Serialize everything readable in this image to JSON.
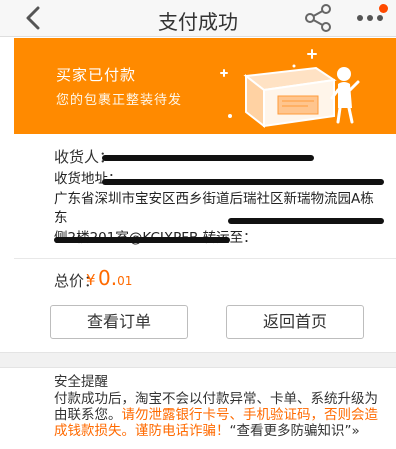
{
  "header": {
    "title": "支付成功",
    "back_icon": "back-arrow-icon",
    "share_icon": "share-icon",
    "more_icon": "more-dots-icon",
    "accent": "#ff8a00"
  },
  "banner": {
    "title": "买家已付款",
    "subtitle": "您的包裹正整装待发",
    "bg_color": "#ff8a00"
  },
  "order": {
    "recipient_label": "收货人：",
    "recipient_value": "",
    "address_label": "收货地址：",
    "address_line1": "广东省深圳市宝安区西乡街道后瑞社区新瑞物流园A栋东",
    "address_line2": "侧2楼201室@KCIXPFB 转运至：",
    "price_label": "总价：",
    "price_currency": "¥",
    "price_main": "0.",
    "price_cents": "01"
  },
  "actions": {
    "view_order": "查看订单",
    "back_home": "返回首页"
  },
  "tips": {
    "title": "安全提醒",
    "body": "付款成功后，淘宝不会以付款异常、卡单、系统升级为由联系您。",
    "warning": "请勿泄露银行卡号、手机验证码，否则会造成钱款损失。谨防电话诈骗！",
    "link": "“查看更多防骗知识”",
    "link_arrows": "»"
  }
}
